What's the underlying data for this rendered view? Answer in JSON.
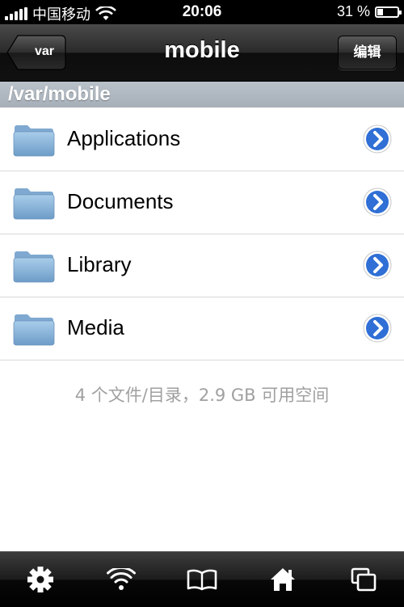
{
  "status_bar": {
    "carrier": "中国移动",
    "time": "20:06",
    "battery_text": "31 %",
    "battery_level": 0.31
  },
  "nav": {
    "back_label": "var",
    "title": "mobile",
    "edit_label": "编辑"
  },
  "path": "/var/mobile",
  "items": [
    {
      "name": "Applications",
      "icon": "folder-icon"
    },
    {
      "name": "Documents",
      "icon": "folder-icon"
    },
    {
      "name": "Library",
      "icon": "folder-icon"
    },
    {
      "name": "Media",
      "icon": "folder-icon"
    }
  ],
  "footer_text": "4 个文件/目录，2.9 GB 可用空间",
  "toolbar": [
    "gear-icon",
    "wifi-icon",
    "book-icon",
    "home-icon",
    "windows-icon"
  ],
  "colors": {
    "disclosure_blue": "#2f6fd6",
    "path_bar": "#a9b2bb",
    "footer_gray": "#a0a0a0"
  }
}
